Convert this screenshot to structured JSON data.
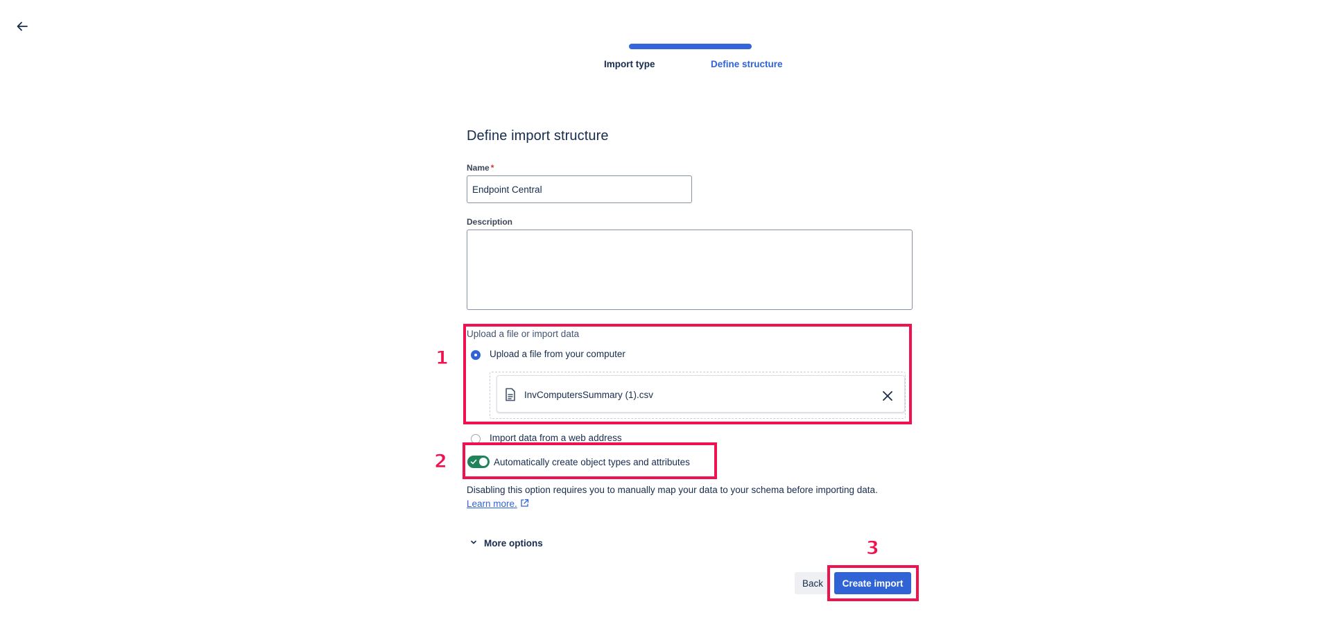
{
  "header": {
    "back_icon": "arrow-left-icon",
    "steps": [
      {
        "label": "Import type",
        "state": "completed"
      },
      {
        "label": "Define structure",
        "state": "current"
      }
    ],
    "progress": 1.0
  },
  "form": {
    "title": "Define import structure",
    "name": {
      "label": "Name",
      "required_marker": "*",
      "value": "Endpoint Central"
    },
    "description": {
      "label": "Description",
      "value": ""
    },
    "source": {
      "label": "Upload a file or import data",
      "options": [
        {
          "label": "Upload a file from your computer",
          "selected": true
        },
        {
          "label": "Import data from a web address",
          "selected": false
        }
      ],
      "file": {
        "name": "InvComputersSummary (1).csv",
        "icon": "file-icon",
        "remove_icon": "close-icon"
      }
    },
    "auto_create": {
      "label": "Automatically create object types and attributes",
      "enabled": true,
      "help": "Disabling this option requires you to manually map your data to your schema before importing data.",
      "learn_more": "Learn more."
    },
    "more_options": "More options",
    "buttons": {
      "back": "Back",
      "create": "Create import"
    }
  },
  "annotations": [
    "1",
    "2",
    "3"
  ],
  "colors": {
    "primary": "#2f63d6",
    "toggle_on": "#1f845a",
    "annotation": "#f0124f",
    "text": "#172b4d"
  }
}
